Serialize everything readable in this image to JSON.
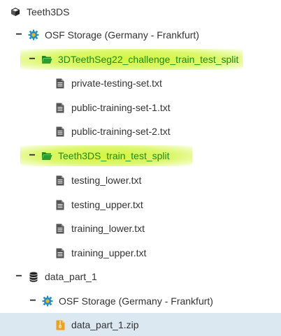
{
  "tree": {
    "project": {
      "label": "Teeth3DS",
      "icon": "cube-icon"
    },
    "storage_1": {
      "toggle": "−",
      "label": "OSF Storage (Germany - Frankfurt)",
      "icon": "storage-gear-icon"
    },
    "folder_1": {
      "toggle": "−",
      "label": "3DTeethSeg22_challenge_train_test_split",
      "icon": "folder-open-icon"
    },
    "file_1": {
      "label": "private-testing-set.txt",
      "icon": "file-text-icon"
    },
    "file_2": {
      "label": "public-training-set-1.txt",
      "icon": "file-text-icon"
    },
    "file_3": {
      "label": "public-training-set-2.txt",
      "icon": "file-text-icon"
    },
    "folder_2": {
      "toggle": "−",
      "label": "Teeth3DS_train_test_split",
      "icon": "folder-open-icon"
    },
    "file_4": {
      "label": "testing_lower.txt",
      "icon": "file-text-icon"
    },
    "file_5": {
      "label": "testing_upper.txt",
      "icon": "file-text-icon"
    },
    "file_6": {
      "label": "training_lower.txt",
      "icon": "file-text-icon"
    },
    "file_7": {
      "label": "training_upper.txt",
      "icon": "file-text-icon"
    },
    "component": {
      "toggle": "−",
      "label": "data_part_1",
      "icon": "database-icon"
    },
    "storage_2": {
      "toggle": "−",
      "label": "OSF Storage (Germany - Frankfurt)",
      "icon": "storage-gear-icon"
    },
    "file_zip": {
      "label": "data_part_1.zip",
      "icon": "file-zip-icon",
      "selected": true
    }
  },
  "colors": {
    "highlight": "#d2f53c",
    "folder_text": "#1f8a1f",
    "selected_row": "#dbe8f1",
    "storage_icon": "#1f8fc7",
    "zip_icon": "#f0a020"
  }
}
